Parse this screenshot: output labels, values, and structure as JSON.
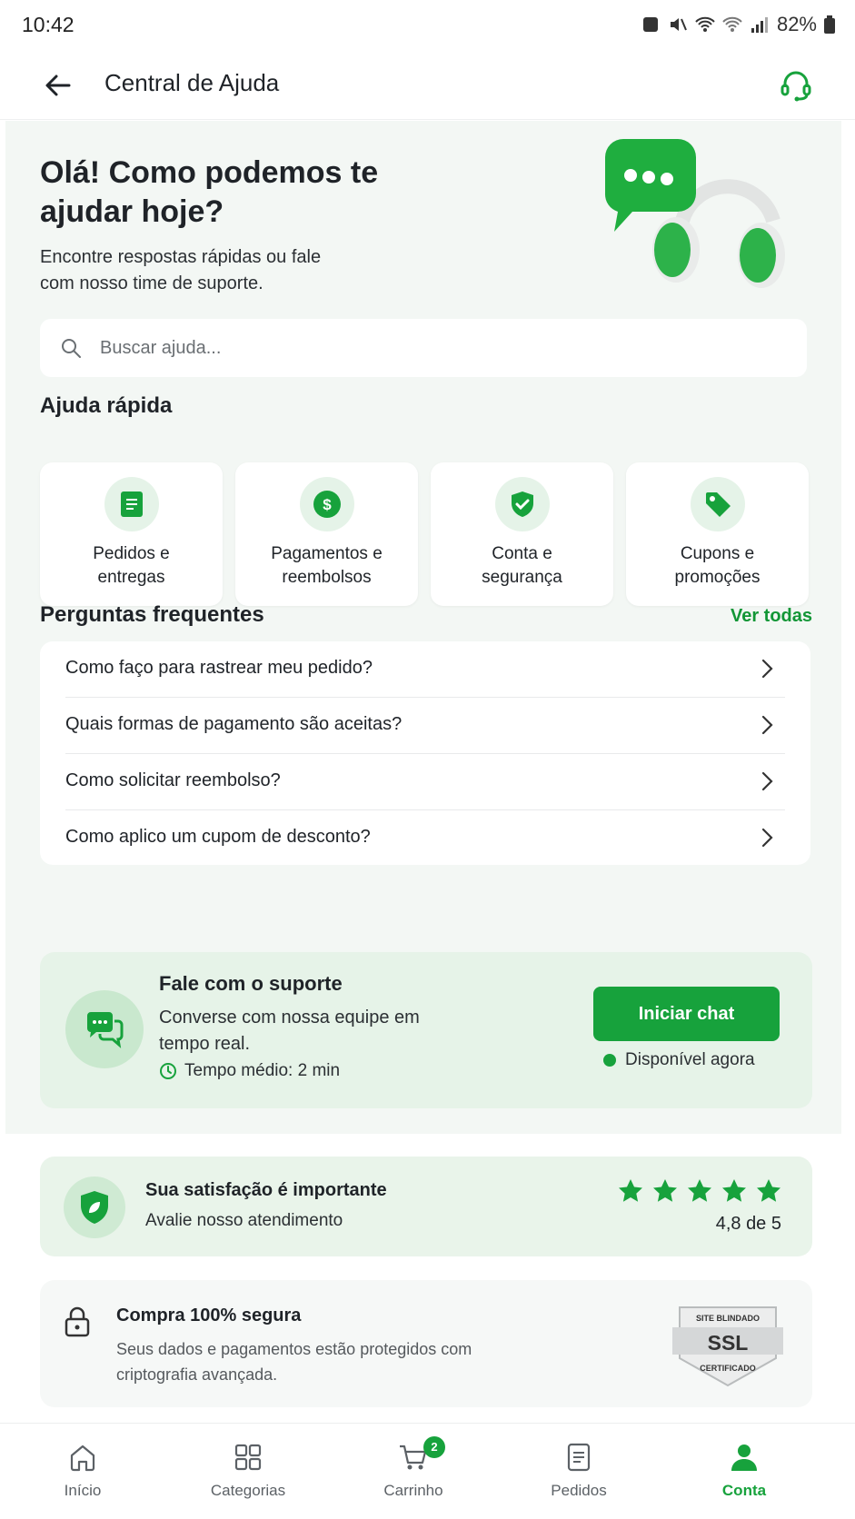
{
  "status_bar": {
    "time": "10:42",
    "battery": "82%"
  },
  "app_bar": {
    "title": "Central de Ajuda"
  },
  "hero": {
    "title": "Olá! Como podemos te ajudar hoje?",
    "subtitle": "Encontre respostas rápidas ou fale com nosso time de suporte."
  },
  "search": {
    "placeholder": "Buscar ajuda..."
  },
  "quick_help": {
    "title": "Ajuda rápida",
    "items": [
      {
        "label": "Pedidos e entregas",
        "icon": "document-icon"
      },
      {
        "label": "Pagamentos e reembolsos",
        "icon": "dollar-icon"
      },
      {
        "label": "Conta e segurança",
        "icon": "shield-check-icon"
      },
      {
        "label": "Cupons e promoções",
        "icon": "tag-icon"
      }
    ]
  },
  "faq": {
    "title": "Perguntas frequentes",
    "see_all": "Ver todas",
    "items": [
      "Como faço para rastrear meu pedido?",
      "Quais formas de pagamento são aceitas?",
      "Como solicitar reembolso?",
      "Como aplico um cupom de desconto?"
    ]
  },
  "support": {
    "title": "Fale com o suporte",
    "description": "Converse com nossa equipe em tempo real.",
    "avg_time": "Tempo médio: 2 min",
    "button": "Iniciar chat",
    "availability": "Disponível agora"
  },
  "rating": {
    "title": "Sua satisfação é importante",
    "subtitle": "Avalie nosso atendimento",
    "stars": 5,
    "value": "4,8 de 5"
  },
  "secure": {
    "title": "Compra 100% segura",
    "description": "Seus dados e pagamentos estão protegidos com criptografia avançada.",
    "badge_top": "SITE BLINDADO",
    "badge_main": "SSL",
    "badge_bottom": "CERTIFICADO"
  },
  "bottom_nav": {
    "items": [
      {
        "label": "Início",
        "icon": "home-icon"
      },
      {
        "label": "Categorias",
        "icon": "grid-icon"
      },
      {
        "label": "Carrinho",
        "icon": "cart-icon",
        "badge": "2"
      },
      {
        "label": "Pedidos",
        "icon": "orders-icon"
      },
      {
        "label": "Conta",
        "icon": "person-icon",
        "active": true
      }
    ]
  },
  "colors": {
    "accent": "#17a23c",
    "accent_light": "#e6f3e8",
    "background": "#f3f7f4"
  }
}
